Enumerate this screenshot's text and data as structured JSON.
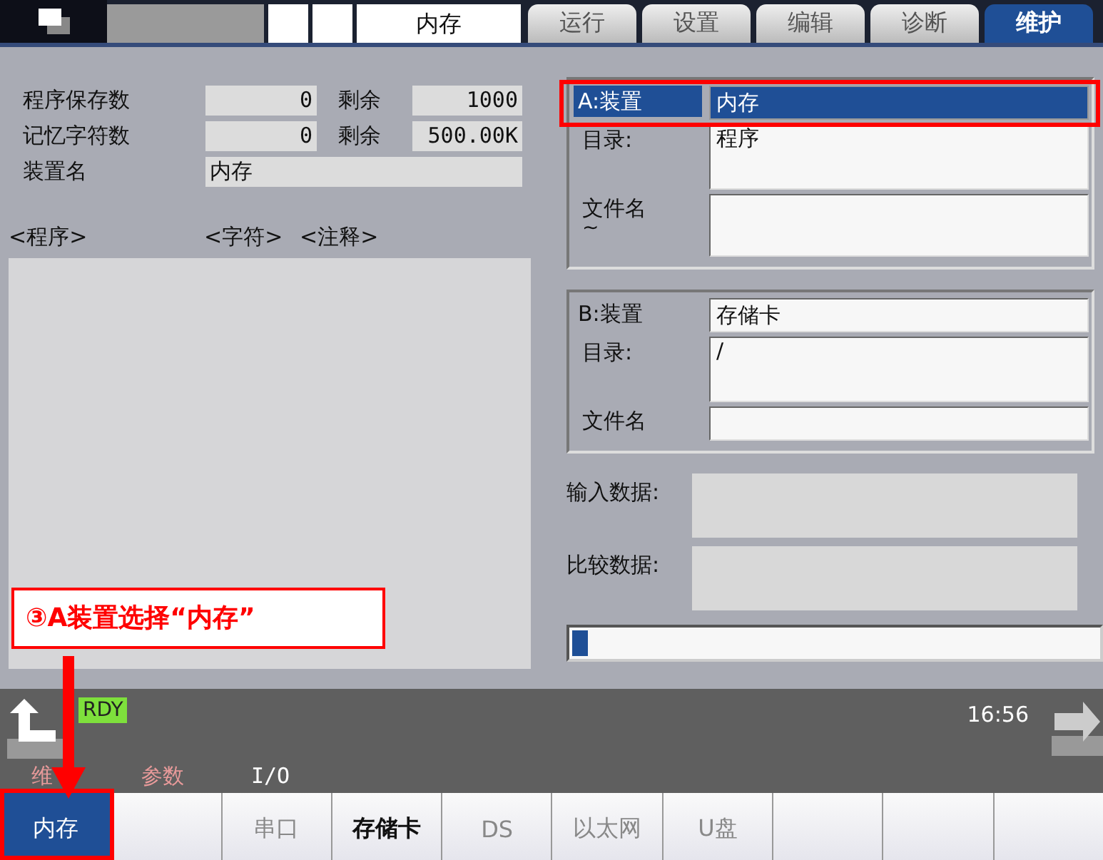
{
  "header": {
    "mode_label": "内存"
  },
  "tabs": [
    {
      "label": "运行",
      "selected": false
    },
    {
      "label": "设置",
      "selected": false
    },
    {
      "label": "编辑",
      "selected": false
    },
    {
      "label": "诊断",
      "selected": false
    },
    {
      "label": "维护",
      "selected": true
    }
  ],
  "program_info": [
    {
      "label": "程序保存数",
      "value": "0",
      "remain_label": "剩余",
      "remain_value": "1000"
    },
    {
      "label": "记忆字符数",
      "value": "0",
      "remain_label": "剩余",
      "remain_value": "500.00K"
    }
  ],
  "device_name": {
    "label": "装置名",
    "value": "内存"
  },
  "list": {
    "columns": [
      "<程序>",
      "<字符>",
      "<注释>"
    ]
  },
  "devices": [
    {
      "device_label": "A:装置",
      "device_value": "内存",
      "active": true,
      "dir_label": "目录:",
      "dir_value": "程序",
      "file_label": "文件名",
      "file_note": "~"
    },
    {
      "device_label": "B:装置",
      "device_value": "存储卡",
      "active": false,
      "dir_label": "目录:",
      "dir_value": "/",
      "file_label": "文件名"
    }
  ],
  "data_fields": [
    {
      "label": "输入数据:"
    },
    {
      "label": "比较数据:"
    }
  ],
  "progress": {
    "level": 0.03
  },
  "status": {
    "state": "RDY",
    "time": "16:56"
  },
  "menu_path": [
    {
      "label": "维",
      "kind": "history"
    },
    {
      "label": "参数",
      "kind": "history"
    },
    {
      "label": "I/O",
      "kind": "current"
    }
  ],
  "softkeys": [
    {
      "label": "内存",
      "selected": true,
      "disabled": false
    },
    {
      "selected": false
    },
    {
      "label": "串口",
      "selected": false,
      "disabled": true
    },
    {
      "label": "存储卡",
      "selected": false,
      "disabled": false
    },
    {
      "label": "DS",
      "selected": false,
      "disabled": true
    },
    {
      "label": "以太网",
      "selected": false,
      "disabled": true
    },
    {
      "label": "U盘",
      "selected": false,
      "disabled": true
    },
    {
      "selected": false
    },
    {
      "selected": false
    },
    {
      "selected": false
    }
  ],
  "annotation": {
    "text": "③A装置选择“内存”"
  }
}
